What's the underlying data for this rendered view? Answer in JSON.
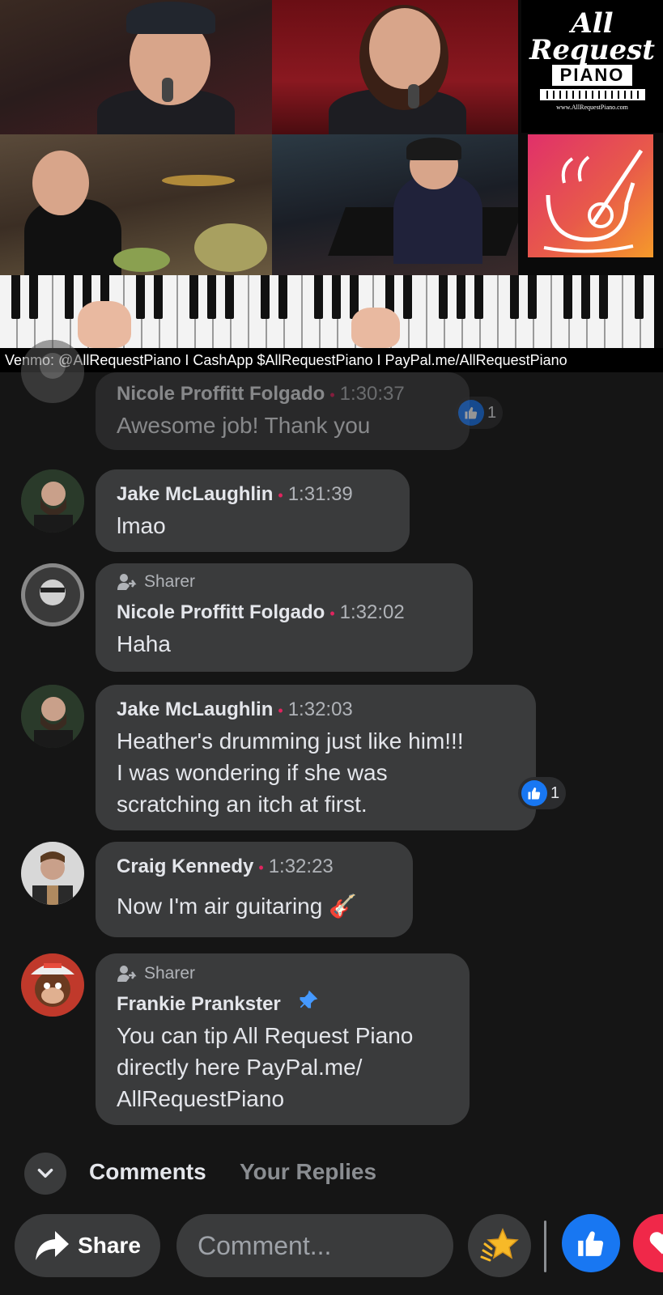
{
  "video": {
    "logo_line1": "All",
    "logo_line2": "Request",
    "logo_line3": "PIANO",
    "logo_url": "www.AllRequestPiano.com",
    "donate_text": "Venmo: @AllRequestPiano  I  CashApp $AllRequestPiano  I  PayPal.me/AllRequestPiano"
  },
  "comments": [
    {
      "name": "Nicole Proffitt Folgado",
      "time": "1:30:37",
      "text": "Awesome job! Thank you",
      "likes": "1"
    },
    {
      "name": "Jake McLaughlin",
      "time": "1:31:39",
      "text": "lmao"
    },
    {
      "badge": "Sharer",
      "name": "Nicole Proffitt Folgado",
      "time": "1:32:02",
      "text": "Haha"
    },
    {
      "name": "Jake McLaughlin",
      "time": "1:32:03",
      "text_lines": [
        "Heather's drumming just like him!!!",
        "I was wondering if she was",
        "scratching an itch at first."
      ],
      "likes": "1"
    },
    {
      "name": "Craig Kennedy",
      "time": "1:32:23",
      "text": "Now I'm air guitaring 🎸"
    },
    {
      "badge": "Sharer",
      "name": "Frankie Prankster",
      "text_lines": [
        "You can tip All Request Piano",
        "directly here PayPal.me/",
        "AllRequestPiano"
      ]
    }
  ],
  "tabs": {
    "comments": "Comments",
    "your_replies": "Your Replies"
  },
  "composer": {
    "share_label": "Share",
    "comment_placeholder": "Comment..."
  },
  "colors": {
    "background": "#151515",
    "bubble": "#3a3b3c",
    "like_blue": "#1877f2",
    "love_red": "#f02849",
    "timestamp_dot": "#e0245e"
  }
}
